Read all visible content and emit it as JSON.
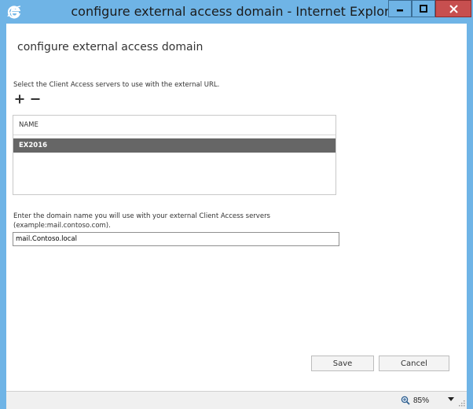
{
  "window": {
    "title": "configure external access domain - Internet Explorer",
    "controls": {
      "minimize_icon": "minimize-icon",
      "maximize_icon": "maximize-icon",
      "close_icon": "close-icon"
    }
  },
  "page": {
    "title": "configure external access domain",
    "servers_instruction": "Select the Client Access servers to use with the external URL.",
    "toolbar": {
      "add_icon": "plus-icon",
      "remove_icon": "minus-icon"
    },
    "table": {
      "columns": [
        "NAME"
      ],
      "rows": [
        {
          "name": "EX2016",
          "selected": true
        }
      ]
    },
    "domain_label_line1": "Enter the domain name you will use with your external Client Access servers",
    "domain_label_line2": "(example:mail.contoso.com).",
    "domain_value": "mail.Contoso.local",
    "save_label": "Save",
    "cancel_label": "Cancel"
  },
  "statusbar": {
    "zoom": "85%"
  },
  "colors": {
    "titlebar": "#6fb4e6",
    "close_button": "#c74f4f",
    "selected_row": "#666666"
  }
}
